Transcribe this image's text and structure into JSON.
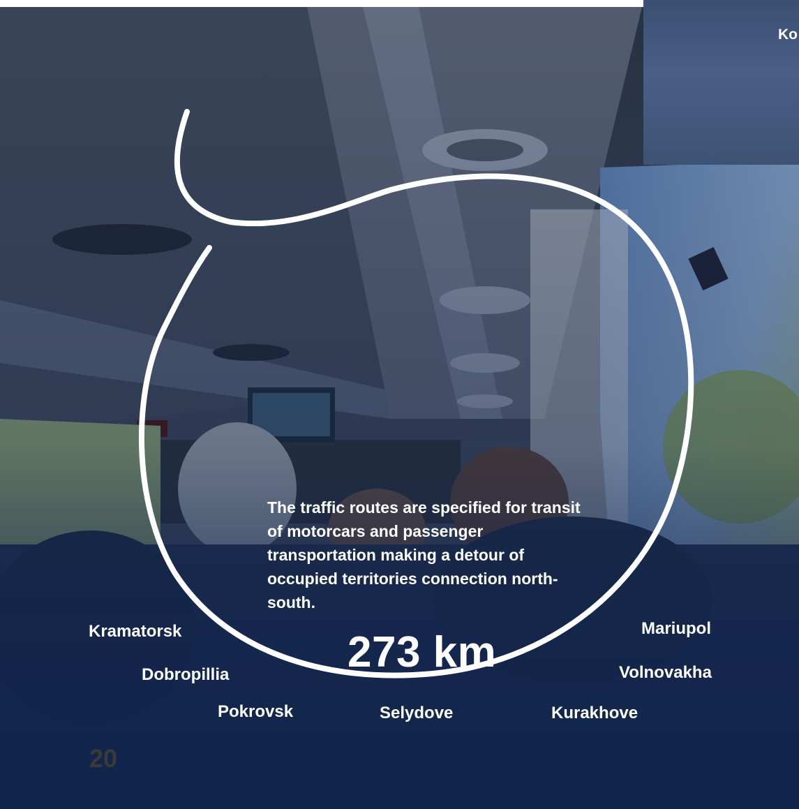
{
  "inset": {
    "label": "Ko"
  },
  "caption": "The traffic routes are specified for transit of motorcars and passenger transportation making a detour of occupied territories connection north-south.",
  "distance": "273 km",
  "cities": {
    "kramatorsk": "Kramatorsk",
    "dobropillia": "Dobropillia",
    "pokrovsk": "Pokrovsk",
    "selydove": "Selydove",
    "kurakhove": "Kurakhove",
    "volnovakha": "Volnovakha",
    "mariupol": "Mariupol"
  },
  "page_number": "20",
  "colors": {
    "overlay": "#12234a",
    "text": "#ffffff",
    "page_number": "#3a3a36"
  }
}
